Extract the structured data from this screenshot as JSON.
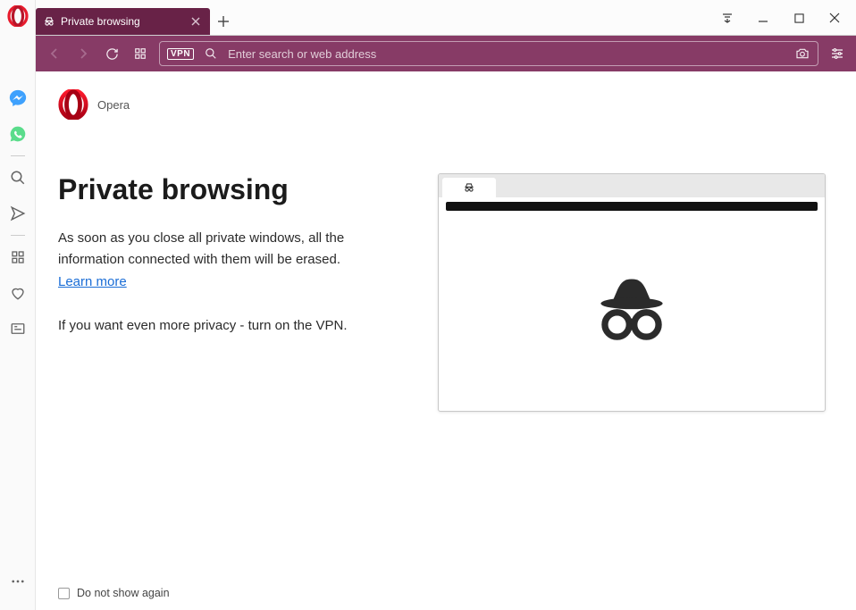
{
  "colors": {
    "tab_bg": "#682247",
    "addr_bg": "#873b66",
    "link": "#1a6dd6",
    "opera_red": "#e81c2d"
  },
  "tab": {
    "title": "Private browsing"
  },
  "addrbar": {
    "vpn_label": "VPN",
    "placeholder": "Enter search or web address"
  },
  "brand": {
    "name": "Opera"
  },
  "page": {
    "heading": "Private browsing",
    "body1": "As soon as you close all private windows, all the information connected with them will be erased.",
    "learn_more": "Learn more",
    "body2": "If you want even more privacy - turn on the VPN."
  },
  "footer": {
    "dont_show": "Do not show again"
  },
  "sidebar": {
    "icons": [
      "messenger",
      "whatsapp",
      "search",
      "send",
      "speeddial",
      "heart",
      "news"
    ]
  }
}
